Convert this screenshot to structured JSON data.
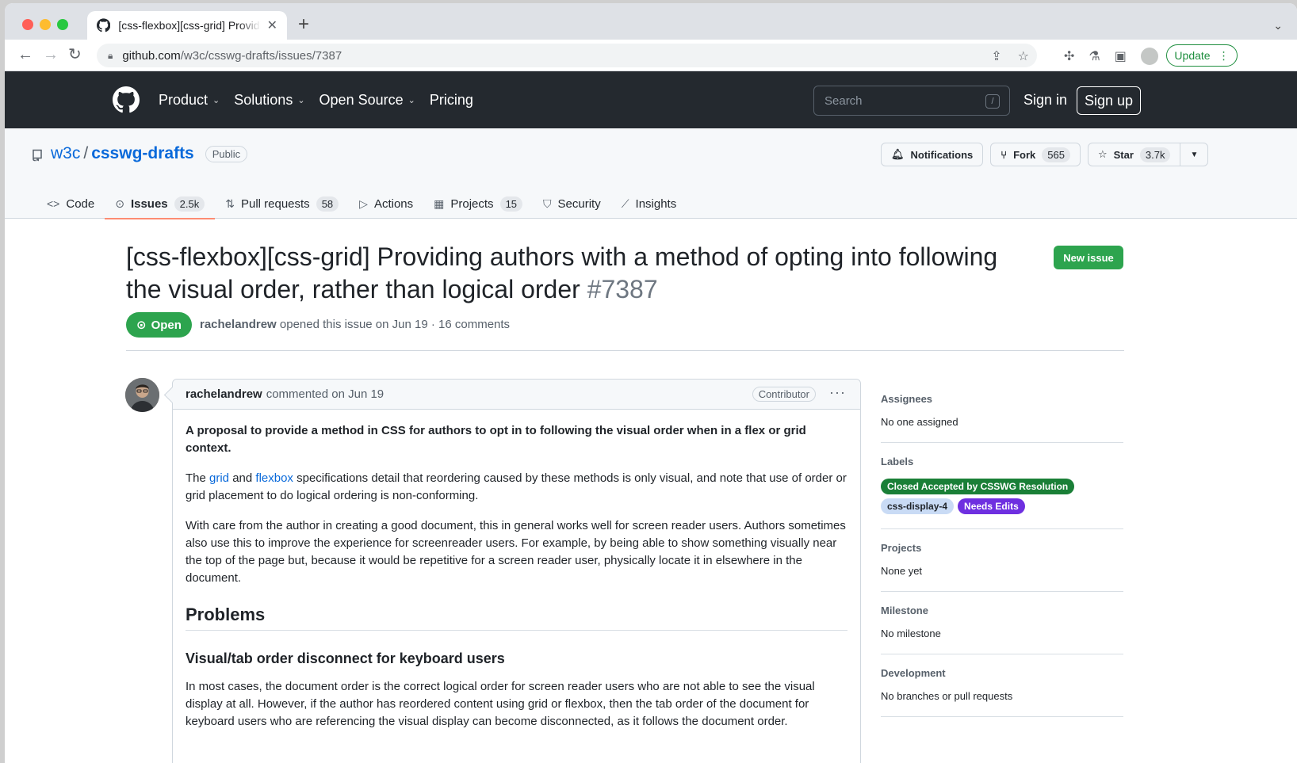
{
  "browser": {
    "tab_title": "[css-flexbox][css-grid] Providing authors with a method of opting into following the visual order",
    "url_host": "github.com",
    "url_path": "/w3c/csswg-drafts/issues/7387",
    "update_label": "Update"
  },
  "gh_header": {
    "nav": [
      "Product",
      "Solutions",
      "Open Source",
      "Pricing"
    ],
    "search_placeholder": "Search",
    "search_shortcut": "/",
    "signin": "Sign in",
    "signup": "Sign up"
  },
  "repo": {
    "owner": "w3c",
    "name": "csswg-drafts",
    "visibility": "Public",
    "notifications_label": "Notifications",
    "fork_label": "Fork",
    "fork_count": "565",
    "star_label": "Star",
    "star_count": "3.7k",
    "tabs": [
      {
        "label": "Code",
        "count": ""
      },
      {
        "label": "Issues",
        "count": "2.5k"
      },
      {
        "label": "Pull requests",
        "count": "58"
      },
      {
        "label": "Actions",
        "count": ""
      },
      {
        "label": "Projects",
        "count": "15"
      },
      {
        "label": "Security",
        "count": ""
      },
      {
        "label": "Insights",
        "count": ""
      }
    ]
  },
  "issue": {
    "title": "[css-flexbox][css-grid] Providing authors with a method of opting into following the visual order, rather than logical order",
    "number": "#7387",
    "new_issue_label": "New issue",
    "state": "Open",
    "author": "rachelandrew",
    "meta_text": "opened this issue on Jun 19 · 16 comments"
  },
  "comment": {
    "author": "rachelandrew",
    "action": "commented on Jun 19",
    "role": "Contributor",
    "p1": "A proposal to provide a method in CSS for authors to opt in to following the visual order when in a flex or grid context.",
    "p2_a": "The ",
    "p2_link1": "grid",
    "p2_b": " and ",
    "p2_link2": "flexbox",
    "p2_c": " specifications detail that reordering caused by these methods is only visual, and note that use of order or grid placement to do logical ordering is non-conforming.",
    "p3": "With care from the author in creating a good document, this in general works well for screen reader users. Authors sometimes also use this to improve the experience for screenreader users. For example, by being able to show something visually near the top of the page but, because it would be repetitive for a screen reader user, physically locate it in elsewhere in the document.",
    "h2": "Problems",
    "h3": "Visual/tab order disconnect for keyboard users",
    "p4": "In most cases, the document order is the correct logical order for screen reader users who are not able to see the visual display at all. However, if the author has reordered content using grid or flexbox, then the tab order of the document for keyboard users who are referencing the visual display can become disconnected, as it follows the document order."
  },
  "sidebar": {
    "assignees_title": "Assignees",
    "assignees_value": "No one assigned",
    "labels_title": "Labels",
    "labels": [
      {
        "name": "Closed Accepted by CSSWG Resolution",
        "bg": "#1a7f37",
        "fg": "#ffffff"
      },
      {
        "name": "css-display-4",
        "bg": "#c9dbf5",
        "fg": "#1f2328"
      },
      {
        "name": "Needs Edits",
        "bg": "#6e2fe0",
        "fg": "#ffffff"
      }
    ],
    "projects_title": "Projects",
    "projects_value": "None yet",
    "milestone_title": "Milestone",
    "milestone_value": "No milestone",
    "development_title": "Development",
    "development_value": "No branches or pull requests"
  }
}
